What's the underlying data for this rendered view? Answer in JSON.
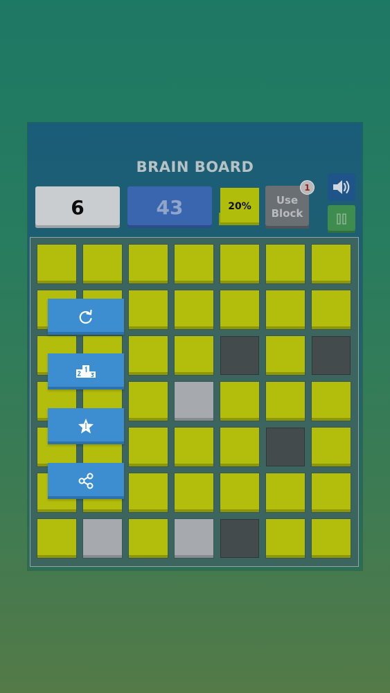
{
  "game": {
    "title": "BRAIN BOARD",
    "level": "6",
    "points": "43",
    "progress_label": "20%",
    "use_block_line1": "Use",
    "use_block_line2": "Block",
    "use_block_count": "1"
  },
  "icons": {
    "sound": "speaker-icon",
    "pause": "pause-icon",
    "restart": "restart-icon",
    "leaderboard": "podium-icon",
    "rate": "star-icon",
    "share": "share-icon"
  },
  "board": {
    "rows": 7,
    "cols": 7,
    "cells": [
      [
        "yellow",
        "yellow",
        "yellow",
        "yellow",
        "yellow",
        "yellow",
        "yellow"
      ],
      [
        "yellow",
        "yellow",
        "yellow",
        "yellow",
        "yellow",
        "yellow",
        "yellow"
      ],
      [
        "yellow",
        "yellow",
        "yellow",
        "yellow",
        "dark",
        "yellow",
        "dark"
      ],
      [
        "yellow",
        "yellow",
        "yellow",
        "light",
        "yellow",
        "yellow",
        "yellow"
      ],
      [
        "yellow",
        "yellow",
        "yellow",
        "yellow",
        "yellow",
        "dark",
        "yellow"
      ],
      [
        "yellow",
        "yellow",
        "yellow",
        "yellow",
        "yellow",
        "yellow",
        "yellow"
      ],
      [
        "yellow",
        "light",
        "yellow",
        "light",
        "dark",
        "yellow",
        "yellow"
      ]
    ]
  },
  "colors": {
    "tile_yellow": "#b3bd0c",
    "tile_light": "#a6aaae",
    "tile_dark": "#434b4d",
    "button_blue": "#3d8ed0",
    "points_blue": "#3a66b0"
  }
}
